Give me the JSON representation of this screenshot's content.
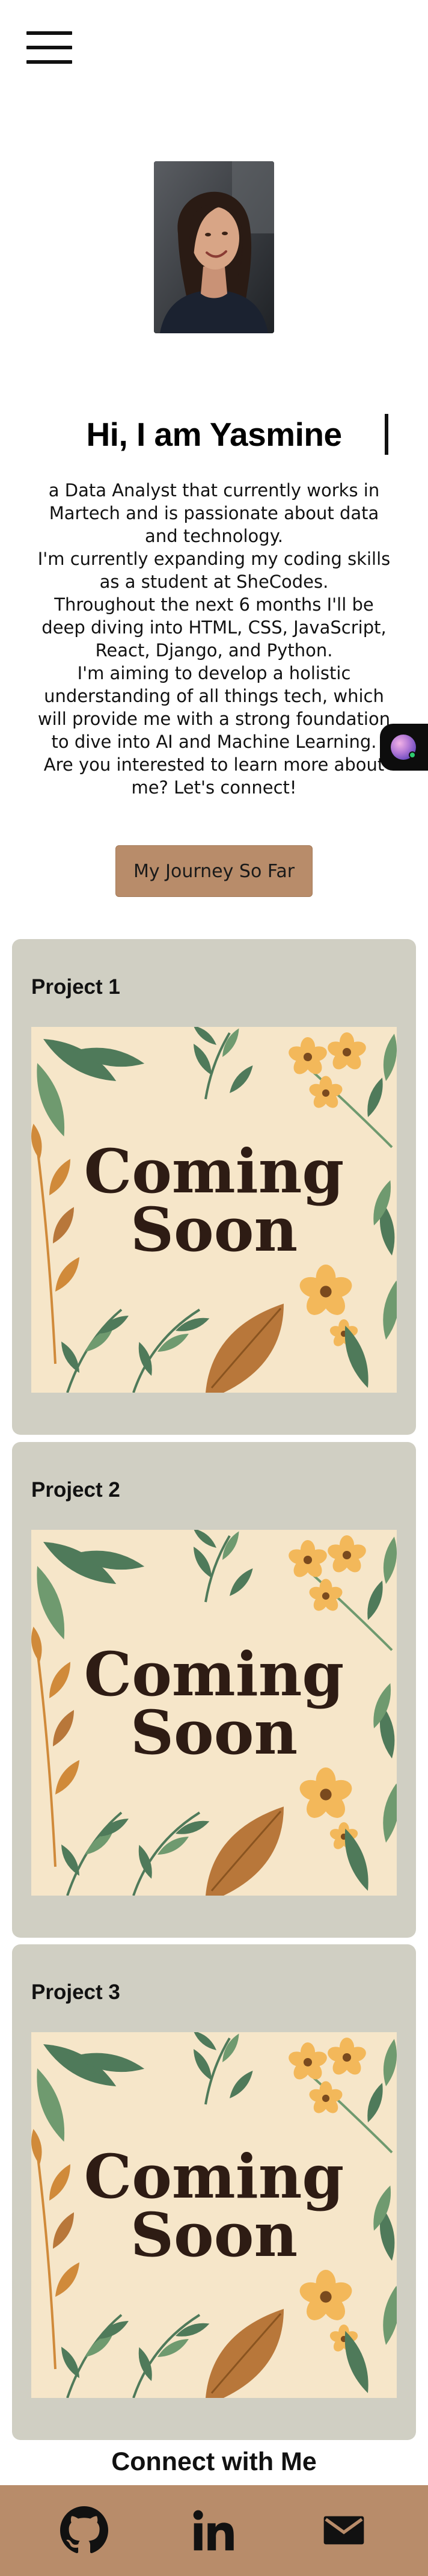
{
  "header": {
    "menu_icon": "hamburger-menu-icon"
  },
  "hero": {
    "title": "Hi, I am Yasmine",
    "bio": [
      "a Data Analyst that currently works in Martech and is passionate about data and technology.",
      "I'm currently expanding my coding skills as a student at SheCodes.",
      "Throughout the next 6 months I'll be deep diving into HTML, CSS, JavaScript, React, Django, and Python.",
      "I'm aiming to develop a holistic understanding of all things tech, which will provide me with a strong foundation to dive into AI and Machine Learning.",
      "Are you interested to learn more about me? Let's connect!"
    ],
    "button_label": "My Journey So Far"
  },
  "projects": [
    {
      "title": "Project 1",
      "image_text_line1": "Coming",
      "image_text_line2": "Soon"
    },
    {
      "title": "Project 2",
      "image_text_line1": "Coming",
      "image_text_line2": "Soon"
    },
    {
      "title": "Project 3",
      "image_text_line1": "Coming",
      "image_text_line2": "Soon"
    }
  ],
  "connect": {
    "title": "Connect with Me",
    "links": [
      {
        "icon": "github-icon"
      },
      {
        "icon": "linkedin-icon"
      },
      {
        "icon": "email-icon"
      }
    ]
  },
  "colors": {
    "accent": "#b88c6a",
    "card_bg": "#d0cfc3",
    "image_bg": "#f6e6c9",
    "coming_soon_text": "#2e1c14"
  }
}
